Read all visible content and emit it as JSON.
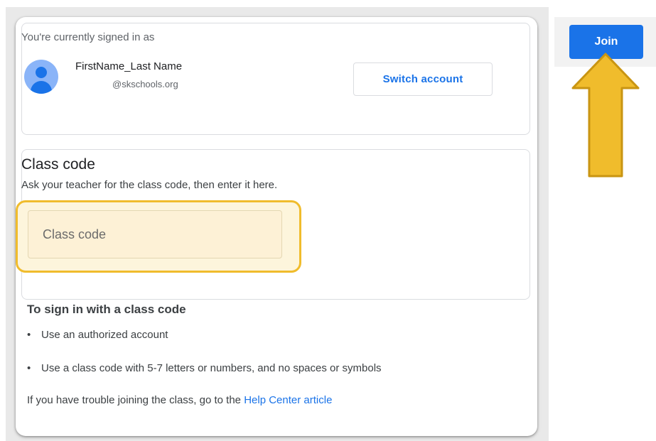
{
  "account": {
    "signed_in_label": "You're currently signed in as",
    "name": "FirstName_Last Name",
    "email": "@skschools.org",
    "switch_button": "Switch account",
    "avatar_icon": "person-icon"
  },
  "class_code": {
    "title": "Class code",
    "description": "Ask your teacher for the class code, then enter it here.",
    "input_placeholder": "Class code",
    "input_value": "",
    "highlight_color": "#f0bc2c"
  },
  "help": {
    "title": "To sign in with a class code",
    "bullets": [
      "Use an authorized account",
      "Use a class code with 5-7 letters or numbers, and no spaces or symbols"
    ],
    "trouble_prefix": "If you have trouble joining the class, go to the ",
    "trouble_link": "Help Center article"
  },
  "header": {
    "join_button": "Join",
    "accent_color": "#1a73e8"
  },
  "annotation": {
    "arrow_icon": "up-arrow-icon",
    "arrow_color": "#f0bc2c"
  }
}
